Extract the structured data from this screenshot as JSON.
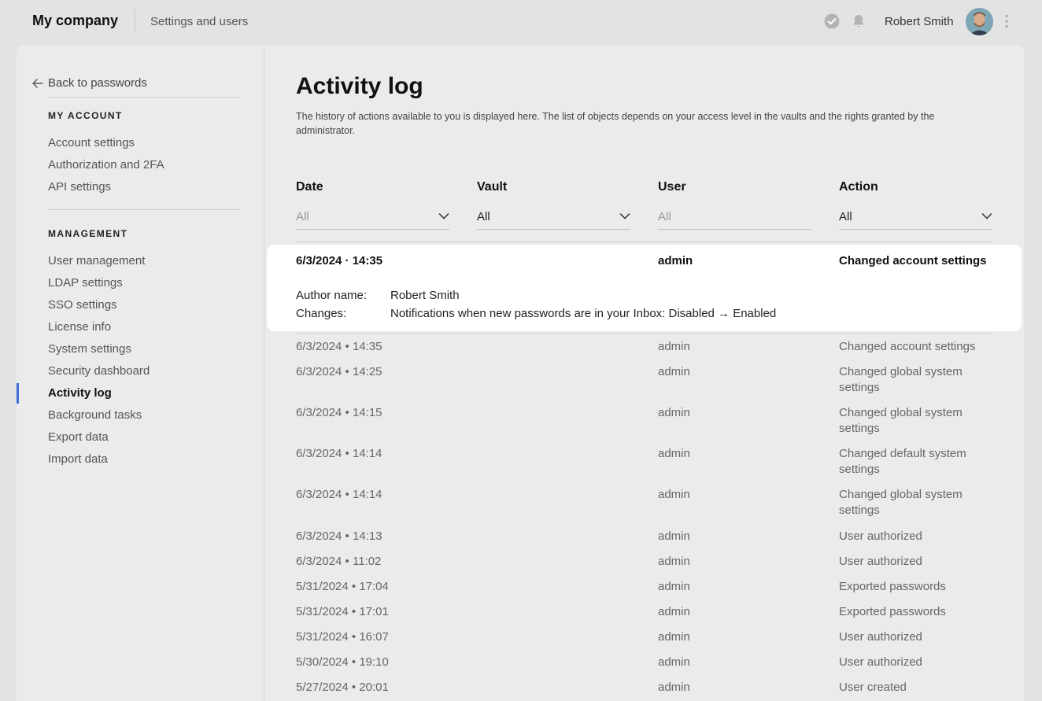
{
  "header": {
    "company": "My company",
    "section": "Settings and users",
    "user_name": "Robert Smith",
    "icons": [
      "check-circle-icon",
      "bell-icon",
      "avatar",
      "more-vertical-icon"
    ]
  },
  "sidebar": {
    "back": "Back to passwords",
    "my_account_heading": "MY ACCOUNT",
    "my_account_items": [
      "Account settings",
      "Authorization and 2FA",
      "API settings"
    ],
    "management_heading": "MANAGEMENT",
    "management_items": [
      "User management",
      "LDAP settings",
      "SSO settings",
      "License info",
      "System settings",
      "Security dashboard",
      "Activity log",
      "Background tasks",
      "Export data",
      "Import data"
    ],
    "active_item": "Activity log",
    "accent_color": "#3c6fd9"
  },
  "main": {
    "title": "Activity log",
    "description": "The history of actions available to you is displayed here. The list of objects depends on your access level in the vaults and the rights granted by the administrator.",
    "columns": {
      "date": "Date",
      "vault": "Vault",
      "user": "User",
      "action": "Action"
    },
    "filters": {
      "date": "All",
      "vault": "All",
      "user_placeholder": "All",
      "action": "All"
    },
    "expanded": {
      "date": "6/3/2024 · 14:35",
      "user": "admin",
      "action": "Changed account settings",
      "author_label": "Author name:",
      "author_value": "Robert Smith",
      "changes_label": "Changes:",
      "changes_value": "Notifications when new passwords are in your Inbox: Disabled → Enabled"
    },
    "rows": [
      {
        "date": "6/3/2024 • 14:35",
        "user": "admin",
        "action": "Changed account settings"
      },
      {
        "date": "6/3/2024 • 14:25",
        "user": "admin",
        "action": "Changed global system settings"
      },
      {
        "date": "6/3/2024 • 14:15",
        "user": "admin",
        "action": "Changed global system settings"
      },
      {
        "date": "6/3/2024 • 14:14",
        "user": "admin",
        "action": "Changed default system settings"
      },
      {
        "date": "6/3/2024 • 14:14",
        "user": "admin",
        "action": "Changed global system settings"
      },
      {
        "date": "6/3/2024 • 14:13",
        "user": "admin",
        "action": "User authorized"
      },
      {
        "date": "6/3/2024 • 11:02",
        "user": "admin",
        "action": "User authorized"
      },
      {
        "date": "5/31/2024 • 17:04",
        "user": "admin",
        "action": "Exported passwords"
      },
      {
        "date": "5/31/2024 • 17:01",
        "user": "admin",
        "action": "Exported passwords"
      },
      {
        "date": "5/31/2024 • 16:07",
        "user": "admin",
        "action": "User authorized"
      },
      {
        "date": "5/30/2024 • 19:10",
        "user": "admin",
        "action": "User authorized"
      },
      {
        "date": "5/27/2024 • 20:01",
        "user": "admin",
        "action": "User created"
      }
    ]
  }
}
